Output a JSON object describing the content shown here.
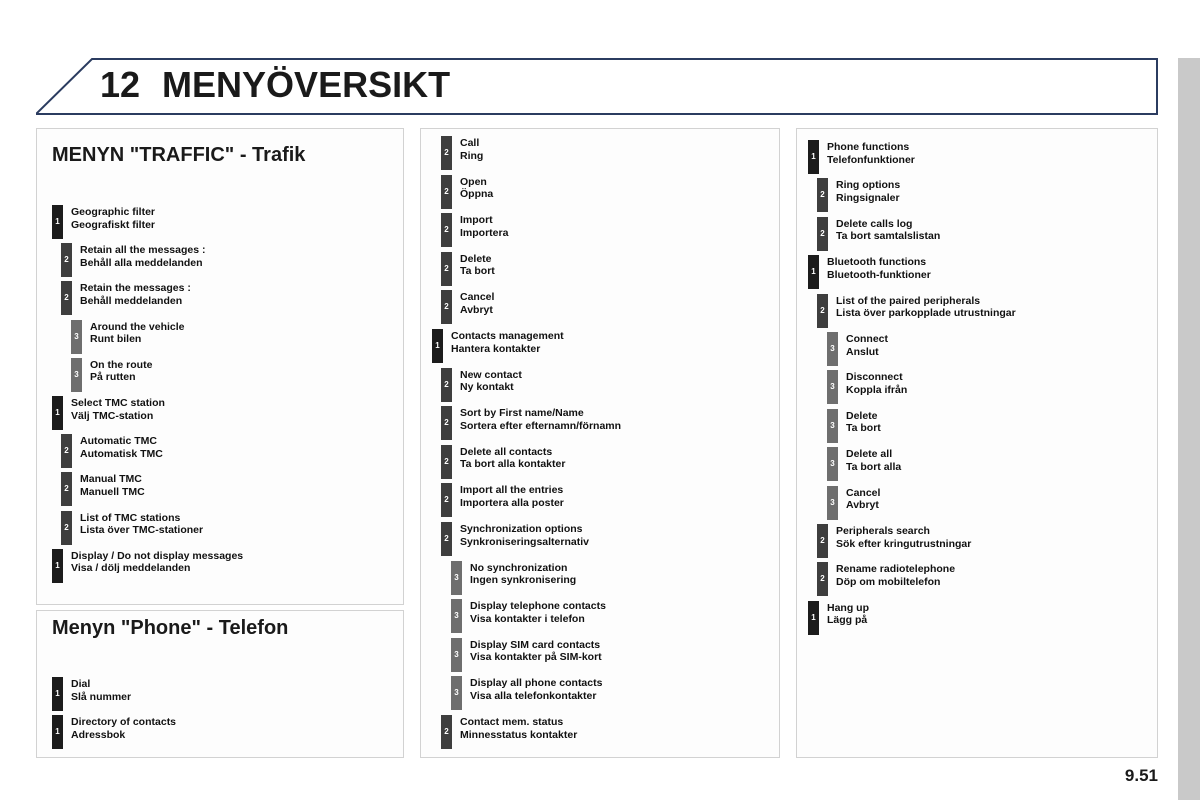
{
  "header": {
    "chapter_number": "12",
    "title": "MENYÖVERSIKT",
    "accent_color": "#2b3c60"
  },
  "page_number": "9.51",
  "level_colors": {
    "level1": "#1c1c1c",
    "level2": "#3e3e3e",
    "level3": "#6e6e6e"
  },
  "panels": {
    "traffic": {
      "title": "MENYN \"TRAFFIC\" - Trafik",
      "items": [
        {
          "level": 1,
          "en": "Geographic filter",
          "sv": "Geografiskt filter"
        },
        {
          "level": 2,
          "en": "Retain all the messages :",
          "sv": "Behåll alla meddelanden"
        },
        {
          "level": 2,
          "en": "Retain the messages :",
          "sv": "Behåll meddelanden"
        },
        {
          "level": 3,
          "en": "Around the vehicle",
          "sv": "Runt bilen"
        },
        {
          "level": 3,
          "en": "On the route",
          "sv": "På rutten"
        },
        {
          "level": 1,
          "en": "Select TMC station",
          "sv": "Välj TMC-station"
        },
        {
          "level": 2,
          "en": "Automatic TMC",
          "sv": "Automatisk TMC"
        },
        {
          "level": 2,
          "en": "Manual TMC",
          "sv": "Manuell TMC"
        },
        {
          "level": 2,
          "en": "List of TMC stations",
          "sv": "Lista över TMC-stationer"
        },
        {
          "level": 1,
          "en": "Display / Do not display messages",
          "sv": "Visa / dölj meddelanden"
        }
      ]
    },
    "phone": {
      "title": "Menyn \"Phone\" - Telefon",
      "items": [
        {
          "level": 1,
          "en": "Dial",
          "sv": "Slå nummer"
        },
        {
          "level": 1,
          "en": "Directory of contacts",
          "sv": "Adressbok"
        }
      ]
    },
    "middle": {
      "items": [
        {
          "level": 2,
          "en": "Call",
          "sv": "Ring"
        },
        {
          "level": 2,
          "en": "Open",
          "sv": "Öppna"
        },
        {
          "level": 2,
          "en": "Import",
          "sv": "Importera"
        },
        {
          "level": 2,
          "en": "Delete",
          "sv": "Ta bort"
        },
        {
          "level": 2,
          "en": "Cancel",
          "sv": "Avbryt"
        },
        {
          "level": 1,
          "en": "Contacts management",
          "sv": "Hantera kontakter"
        },
        {
          "level": 2,
          "en": "New contact",
          "sv": "Ny kontakt"
        },
        {
          "level": 2,
          "en": "Sort by First name/Name",
          "sv": "Sortera efter efternamn/förnamn"
        },
        {
          "level": 2,
          "en": "Delete all contacts",
          "sv": "Ta bort alla kontakter"
        },
        {
          "level": 2,
          "en": "Import all the entries",
          "sv": "Importera alla poster"
        },
        {
          "level": 2,
          "en": "Synchronization options",
          "sv": "Synkroniseringsalternativ"
        },
        {
          "level": 3,
          "en": "No synchronization",
          "sv": "Ingen synkronisering"
        },
        {
          "level": 3,
          "en": "Display telephone contacts",
          "sv": "Visa kontakter i telefon"
        },
        {
          "level": 3,
          "en": "Display SIM card contacts",
          "sv": "Visa kontakter på SIM-kort"
        },
        {
          "level": 3,
          "en": "Display all phone contacts",
          "sv": "Visa alla telefonkontakter"
        },
        {
          "level": 2,
          "en": "Contact mem. status",
          "sv": "Minnesstatus kontakter"
        }
      ]
    },
    "right": {
      "items": [
        {
          "level": 1,
          "en": "Phone functions",
          "sv": "Telefonfunktioner"
        },
        {
          "level": 2,
          "en": "Ring options",
          "sv": "Ringsignaler"
        },
        {
          "level": 2,
          "en": "Delete calls log",
          "sv": "Ta bort samtalslistan"
        },
        {
          "level": 1,
          "en": "Bluetooth functions",
          "sv": "Bluetooth-funktioner"
        },
        {
          "level": 2,
          "en": "List of the paired peripherals",
          "sv": "Lista över parkopplade utrustningar"
        },
        {
          "level": 3,
          "en": "Connect",
          "sv": "Anslut"
        },
        {
          "level": 3,
          "en": "Disconnect",
          "sv": "Koppla ifrån"
        },
        {
          "level": 3,
          "en": "Delete",
          "sv": "Ta bort"
        },
        {
          "level": 3,
          "en": "Delete all",
          "sv": "Ta bort alla"
        },
        {
          "level": 3,
          "en": "Cancel",
          "sv": "Avbryt"
        },
        {
          "level": 2,
          "en": "Peripherals search",
          "sv": "Sök efter kringutrustningar"
        },
        {
          "level": 2,
          "en": "Rename radiotelephone",
          "sv": "Döp om mobiltelefon"
        },
        {
          "level": 1,
          "en": "Hang up",
          "sv": "Lägg på"
        }
      ]
    }
  }
}
